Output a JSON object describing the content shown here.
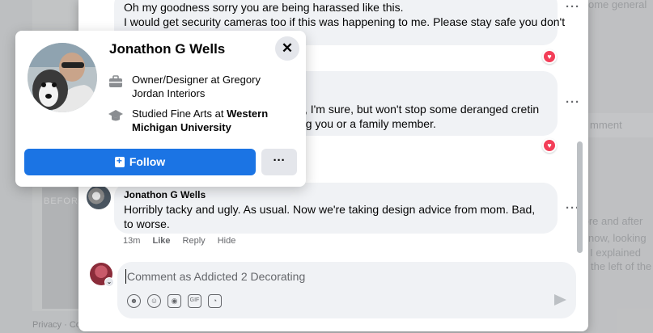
{
  "backdrop": {
    "left_photo_text": "BEFORE",
    "footer_text": "Privacy · Co",
    "right_snippets": [
      "ome general",
      "mment",
      "fore and after",
      "now, looking",
      "s I explained",
      "the left of the"
    ]
  },
  "comments": [
    {
      "line1": "Oh my goodness sorry you are being harassed like this.",
      "line2": "I would get security cameras too if this was happening to me. Please stay safe you don't"
    },
    {
      "line1": "y, I'm sure, but won't stop some deranged cretin",
      "line2": "ng you or a family member."
    },
    {
      "author": "Jonathon G Wells",
      "text": "Horribly tacky and ugly. As usual. Now we're taking design advice from mom. Bad, to worse.",
      "time": "13m",
      "like": "Like",
      "reply": "Reply",
      "hide": "Hide"
    }
  ],
  "composer": {
    "placeholder": "Comment as Addicted 2 Decorating"
  },
  "hover_card": {
    "name": "Jonathon G Wells",
    "work": "Owner/Designer at Gregory Jordan Interiors",
    "edu_prefix": "Studied Fine Arts at ",
    "edu_school": "Western Michigan University",
    "follow_label": "Follow",
    "more_label": "···",
    "close_label": "✕"
  },
  "colors": {
    "primary": "#1b74e4",
    "reaction": "#f33e58",
    "bubble": "#f0f2f5"
  }
}
